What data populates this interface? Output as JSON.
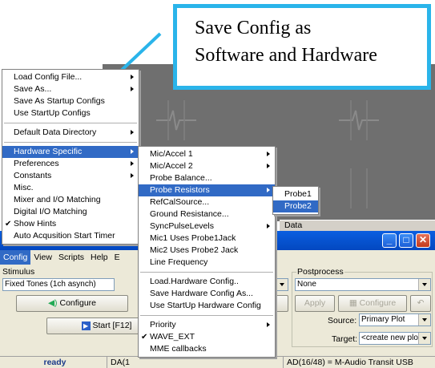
{
  "callout": {
    "line1": "Save Config as",
    "line2": "Software and Hardware"
  },
  "config_menu": {
    "items": [
      {
        "label": "Load Config File...",
        "submenu": true
      },
      {
        "label": "Save As...",
        "submenu": true
      },
      {
        "label": "Save As Startup Configs"
      },
      {
        "label": "Use StartUp Configs"
      },
      {
        "label": "Default Data Directory",
        "submenu": true
      },
      {
        "label": "Hardware Specific",
        "submenu": true,
        "highlighted": true
      },
      {
        "label": "Preferences",
        "submenu": true
      },
      {
        "label": "Constants",
        "submenu": true
      },
      {
        "label": "Misc."
      },
      {
        "label": "Mixer and I/O Matching"
      },
      {
        "label": "Digital I/O Matching"
      },
      {
        "label": "Show Hints",
        "checked": true
      },
      {
        "label": "Auto Acqusition Start Timer"
      }
    ]
  },
  "hardware_menu": {
    "items": [
      {
        "label": "Mic/Accel 1",
        "submenu": true
      },
      {
        "label": "Mic/Accel 2",
        "submenu": true
      },
      {
        "label": "Probe Balance..."
      },
      {
        "label": "Probe Resistors",
        "submenu": true,
        "highlighted": true
      },
      {
        "label": "RefCalSource..."
      },
      {
        "label": "Ground Resistance..."
      },
      {
        "label": "SyncPulseLevels",
        "submenu": true
      },
      {
        "label": "Mic1 Uses Probe1Jack"
      },
      {
        "label": "Mic2 Uses Probe2 Jack"
      },
      {
        "label": "Line Frequency"
      },
      {
        "label": "Load.Hardware Config.."
      },
      {
        "label": "Save Hardware Config As..."
      },
      {
        "label": "Use StartUp Hardware Config"
      },
      {
        "label": "Priority",
        "submenu": true
      },
      {
        "label": "WAVE_EXT",
        "checked": true
      },
      {
        "label": "MME callbacks"
      }
    ]
  },
  "probe_menu": {
    "items": [
      {
        "label": "Probe1"
      },
      {
        "label": "Probe2",
        "highlighted": true
      }
    ]
  },
  "data_tab": "Data",
  "menubar": [
    "Config",
    "View",
    "Scripts",
    "Help",
    "E"
  ],
  "stimulus": {
    "label": "Stimulus",
    "value": "Fixed Tones (1ch asynch)",
    "configure": "Configure",
    "start": "Start [F12]"
  },
  "postprocess": {
    "label": "Postprocess",
    "value": "None",
    "apply": "Apply",
    "configure": "Configure",
    "source_label": "Source:",
    "source_value": "Primary Plot",
    "target_label": "Target:",
    "target_value": "<create new plot>"
  },
  "status": {
    "ready": "ready",
    "da": "DA(1",
    "ad": "AD(16/48) = M-Audio Transit USB"
  },
  "colors": {
    "accent": "#316ac5",
    "callout_border": "#2ab4ea",
    "titlebar": "#0a5ee0"
  }
}
